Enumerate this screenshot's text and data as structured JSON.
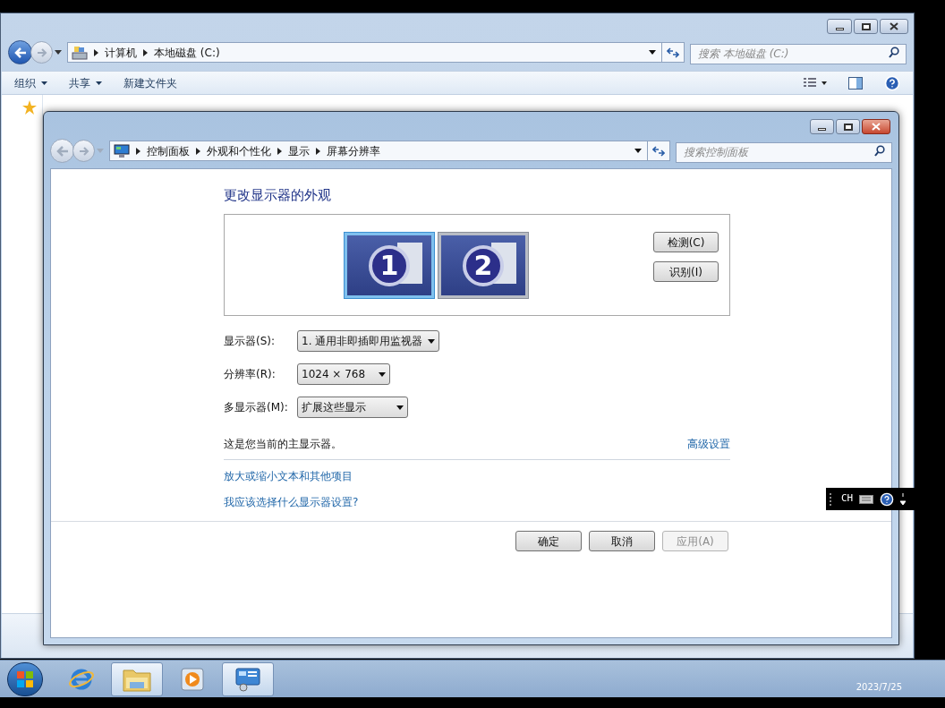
{
  "explorer": {
    "breadcrumb": [
      "计算机",
      "本地磁盘 (C:)"
    ],
    "search": {
      "placeholder": "搜索 本地磁盘 (C:)"
    },
    "toolbar": [
      {
        "label": "组织",
        "dropdown": true
      },
      {
        "label": "共享",
        "dropdown": true
      },
      {
        "label": "新建文件夹",
        "dropdown": false
      }
    ]
  },
  "dialog": {
    "breadcrumb": [
      "控制面板",
      "外观和个性化",
      "显示",
      "屏幕分辨率"
    ],
    "search": {
      "placeholder": "搜索控制面板"
    },
    "heading": "更改显示器的外观",
    "monitors": [
      {
        "number": "1",
        "selected": true
      },
      {
        "number": "2",
        "selected": false
      }
    ],
    "side_buttons": [
      "检测(C)",
      "识别(I)"
    ],
    "settings": [
      {
        "label": "显示器(S):",
        "value": "1. 通用非即插即用监视器"
      },
      {
        "label": "分辨率(R):",
        "value": "1024 × 768"
      },
      {
        "label": "多显示器(M):",
        "value": "扩展这些显示"
      }
    ],
    "status": "这是您当前的主显示器。",
    "advanced_link": "高级设置",
    "links": [
      "放大或缩小文本和其他项目",
      "我应该选择什么显示器设置?"
    ],
    "buttons": [
      {
        "label": "确定",
        "disabled": false
      },
      {
        "label": "取消",
        "disabled": false
      },
      {
        "label": "应用(A)",
        "disabled": true
      }
    ]
  },
  "language_bar": {
    "label": "CH"
  },
  "taskbar": {
    "items": [
      {
        "kind": "ie",
        "open": false
      },
      {
        "kind": "folder",
        "open": true
      },
      {
        "kind": "media",
        "open": false
      },
      {
        "kind": "control-panel",
        "open": true
      }
    ],
    "clock": "2023/7/25"
  }
}
